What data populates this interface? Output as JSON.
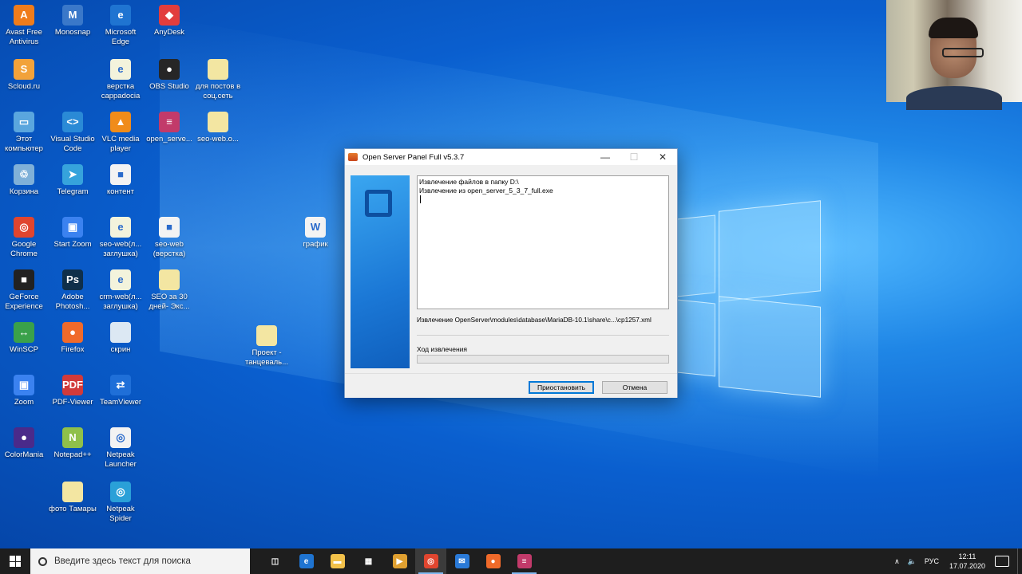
{
  "desktop": {
    "icons": [
      {
        "label": "Avast Free Antivirus",
        "glyph": "A",
        "color": "#f07c1a"
      },
      {
        "label": "Monosnap",
        "glyph": "M",
        "color": "#3a78c9"
      },
      {
        "label": "Microsoft Edge",
        "glyph": "e",
        "color": "#1f74d1"
      },
      {
        "label": "AnyDesk",
        "glyph": "◆",
        "color": "#e23d3d"
      },
      {
        "label": "Scloud.ru",
        "glyph": "S",
        "color": "#f2a23a"
      },
      {
        "label": "верстка cappadocia",
        "glyph": "e",
        "color": "#f3f3dc"
      },
      {
        "label": "OBS Studio",
        "glyph": "●",
        "color": "#262626"
      },
      {
        "label": "для постов в соц.сеть",
        "glyph": "",
        "color": "#f3e6a2"
      },
      {
        "label": "Этот компьютер",
        "glyph": "▭",
        "color": "#5aa6de"
      },
      {
        "label": "Visual Studio Code",
        "glyph": "<>",
        "color": "#2a8ad6"
      },
      {
        "label": "VLC media player",
        "glyph": "▲",
        "color": "#f08c1a"
      },
      {
        "label": "open_serve...",
        "glyph": "≡",
        "color": "#c23a6a"
      },
      {
        "label": "seo-web.o...",
        "glyph": "",
        "color": "#f3e6a2"
      },
      {
        "label": "Корзина",
        "glyph": "♲",
        "color": "#7fb0d8"
      },
      {
        "label": "Telegram",
        "glyph": "➤",
        "color": "#36a3dc"
      },
      {
        "label": "контент",
        "glyph": "■",
        "color": "#f3f3f3"
      },
      {
        "label": "Google Chrome",
        "glyph": "◎",
        "color": "#e0452f"
      },
      {
        "label": "Start Zoom",
        "glyph": "▣",
        "color": "#3b82f0"
      },
      {
        "label": "seo-web(л... заглушка)",
        "glyph": "e",
        "color": "#f3f3dc"
      },
      {
        "label": "seo-web (верстка)",
        "glyph": "■",
        "color": "#f3f3f3"
      },
      {
        "label": "график",
        "glyph": "W",
        "color": "#f3f3f3"
      },
      {
        "label": "GeForce Experience",
        "glyph": "■",
        "color": "#222"
      },
      {
        "label": "Adobe Photosh...",
        "glyph": "Ps",
        "color": "#0f2f4a"
      },
      {
        "label": "crm-web(л... заглушка)",
        "glyph": "e",
        "color": "#f3f3dc"
      },
      {
        "label": "SEO за 30 дней- Экс...",
        "glyph": "",
        "color": "#f3e6a2"
      },
      {
        "label": "WinSCP",
        "glyph": "↔",
        "color": "#3aa14a"
      },
      {
        "label": "Firefox",
        "glyph": "●",
        "color": "#f06a2a"
      },
      {
        "label": "скрин",
        "glyph": "",
        "color": "#dce8f3"
      },
      {
        "label": "Проект - танцеваль...",
        "glyph": "",
        "color": "#f3e6a2"
      },
      {
        "label": "Zoom",
        "glyph": "▣",
        "color": "#3b82f0"
      },
      {
        "label": "PDF-Viewer",
        "glyph": "PDF",
        "color": "#d23a3a"
      },
      {
        "label": "TeamViewer",
        "glyph": "⇄",
        "color": "#1f6fd8"
      },
      {
        "label": "ColorMania",
        "glyph": "●",
        "color": "#4a2a8a"
      },
      {
        "label": "Notepad++",
        "glyph": "N",
        "color": "#8fc04a"
      },
      {
        "label": "Netpeak Launcher",
        "glyph": "◎",
        "color": "#f3f3f3"
      },
      {
        "label": "фото Тамары",
        "glyph": "",
        "color": "#f3e6a2"
      },
      {
        "label": "Netpeak Spider",
        "glyph": "◎",
        "color": "#2aa0d8"
      }
    ]
  },
  "installer": {
    "title": "Open Server Panel Full v5.3.7",
    "log_lines": [
      "Извлечение файлов в папку D:\\",
      "Извлечение из open_server_5_3_7_full.exe"
    ],
    "current_path": "Извлечение OpenServer\\modules\\database\\MariaDB-10.1\\share\\c...\\cp1257.xml",
    "progress_label": "Ход извлечения",
    "progress_fraction": 0.0,
    "pause_label": "Приостановить",
    "cancel_label": "Отмена",
    "minimize_glyph": "—",
    "maximize_glyph": "☐",
    "close_glyph": "✕"
  },
  "taskbar": {
    "search_placeholder": "Введите здесь текст для поиска",
    "apps": [
      {
        "name": "task-view",
        "glyph": "◫",
        "color": "#1e1e1e",
        "state": "none"
      },
      {
        "name": "edge",
        "glyph": "e",
        "color": "#1f74d1",
        "state": "none"
      },
      {
        "name": "file-explorer",
        "glyph": "▬",
        "color": "#f2c14a",
        "state": "none"
      },
      {
        "name": "store",
        "glyph": "▦",
        "color": "#1e1e1e",
        "state": "none"
      },
      {
        "name": "media",
        "glyph": "▶",
        "color": "#e0a030",
        "state": "none"
      },
      {
        "name": "chrome",
        "glyph": "◎",
        "color": "#e0452f",
        "state": "active"
      },
      {
        "name": "mail",
        "glyph": "✉",
        "color": "#2a7ad8",
        "state": "none"
      },
      {
        "name": "firefox",
        "glyph": "●",
        "color": "#f06a2a",
        "state": "none"
      },
      {
        "name": "open-server",
        "glyph": "≡",
        "color": "#c23a6a",
        "state": "running"
      }
    ],
    "tray": {
      "chevron": "∧",
      "volume": "🔈",
      "language": "РУС",
      "time": "12:11",
      "date": "17.07.2020"
    }
  }
}
